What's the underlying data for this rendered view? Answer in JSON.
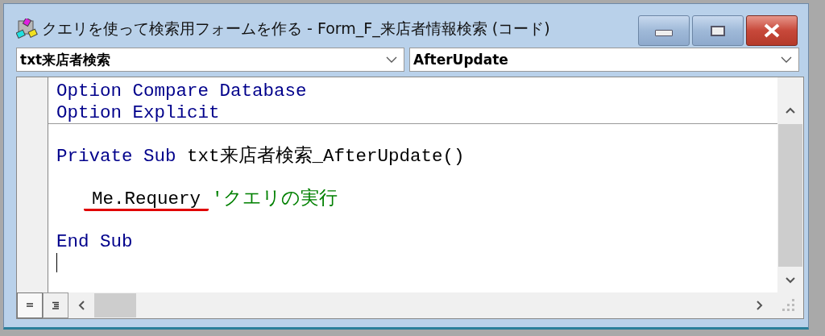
{
  "window": {
    "title": "クエリを使って検索用フォームを作る - Form_F_来店者情報検索 (コード)"
  },
  "object_dropdown": {
    "value": "txt来店者検索"
  },
  "procedure_dropdown": {
    "value": "AfterUpdate"
  },
  "code": {
    "lines": [
      {
        "kind": "code",
        "segments": [
          {
            "text": "Option Compare Database",
            "kind": "keyword"
          }
        ]
      },
      {
        "kind": "code",
        "separator_after": true,
        "segments": [
          {
            "text": "Option Explicit",
            "kind": "keyword"
          }
        ]
      },
      {
        "kind": "blank"
      },
      {
        "kind": "code",
        "segments": [
          {
            "text": "Private Sub ",
            "kind": "keyword"
          },
          {
            "text": "txt来店者検索_AfterUpdate()",
            "kind": "plain"
          }
        ]
      },
      {
        "kind": "blank"
      },
      {
        "kind": "code",
        "indented": true,
        "segments": [
          {
            "text": "Me.Requery",
            "kind": "plain",
            "underlined": true
          },
          {
            "text": "'クエリの実行",
            "kind": "comment"
          }
        ]
      },
      {
        "kind": "blank"
      },
      {
        "kind": "code",
        "segments": [
          {
            "text": "End Sub",
            "kind": "keyword"
          }
        ]
      },
      {
        "kind": "blank",
        "cursor": true
      }
    ]
  }
}
